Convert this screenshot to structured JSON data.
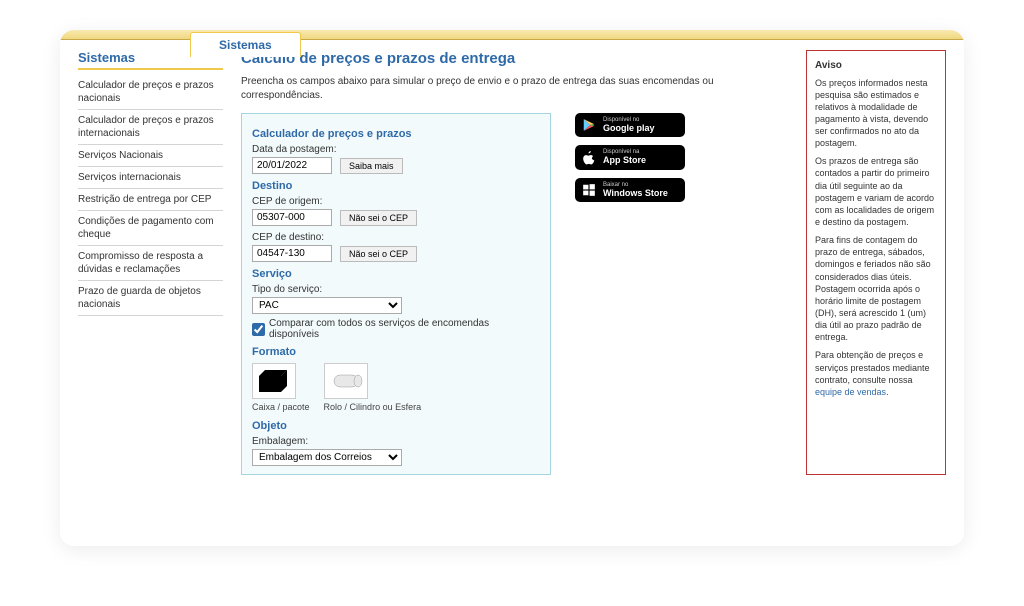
{
  "tab": {
    "label": "Sistemas"
  },
  "sidebar": {
    "title": "Sistemas",
    "items": [
      {
        "label": "Calculador de preços e prazos nacionais"
      },
      {
        "label": "Calculador de preços e prazos internacionais"
      },
      {
        "label": "Serviços Nacionais"
      },
      {
        "label": "Serviços internacionais"
      },
      {
        "label": "Restrição de entrega por CEP"
      },
      {
        "label": "Condições de pagamento com cheque"
      },
      {
        "label": "Compromisso de resposta a dúvidas e reclamações"
      },
      {
        "label": "Prazo de guarda de objetos nacionais"
      }
    ]
  },
  "main": {
    "title": "Cálculo de preços e prazos de entrega",
    "intro": "Preencha os campos abaixo para simular o preço de envio e o prazo de entrega das suas encomendas ou correspondências."
  },
  "form": {
    "sec_calc": "Calculador de preços e prazos",
    "data_label": "Data da postagem:",
    "data_value": "20/01/2022",
    "saiba_mais": "Saiba mais",
    "sec_destino": "Destino",
    "cep_origem_label": "CEP de origem:",
    "cep_origem_value": "05307-000",
    "cep_destino_label": "CEP de destino:",
    "cep_destino_value": "04547-130",
    "nao_sei_cep": "Não sei o CEP",
    "sec_servico": "Serviço",
    "tipo_label": "Tipo do serviço:",
    "tipo_value": "PAC",
    "comparar": "Comparar com todos os serviços de encomendas disponíveis",
    "sec_formato": "Formato",
    "format_caixa": "Caixa / pacote",
    "format_rolo": "Rolo / Cilindro ou Esfera",
    "sec_objeto": "Objeto",
    "embalagem_label": "Embalagem:",
    "embalagem_value": "Embalagem dos Correios"
  },
  "badges": {
    "gp_small": "Disponível no",
    "gp_big": "Google play",
    "as_small": "Disponível na",
    "as_big": "App Store",
    "ws_small": "Baixar no",
    "ws_big": "Windows Store"
  },
  "aside": {
    "title": "Aviso",
    "p1": "Os preços informados nesta pesquisa são estimados e relativos à modalidade de pagamento à vista, devendo ser confirmados no ato da postagem.",
    "p2": "Os prazos de entrega são contados a partir do primeiro dia útil seguinte ao da postagem e variam de acordo com as localidades de origem e destino da postagem.",
    "p3": "Para fins de contagem do prazo de entrega, sábados, domingos e feriados não são considerados dias úteis. Postagem ocorrida após o horário limite de postagem (DH), será acrescido 1 (um) dia útil ao prazo padrão de entrega.",
    "p4a": "Para obtenção de preços e serviços prestados mediante contrato, consulte nossa ",
    "p4b": "equipe de vendas"
  }
}
